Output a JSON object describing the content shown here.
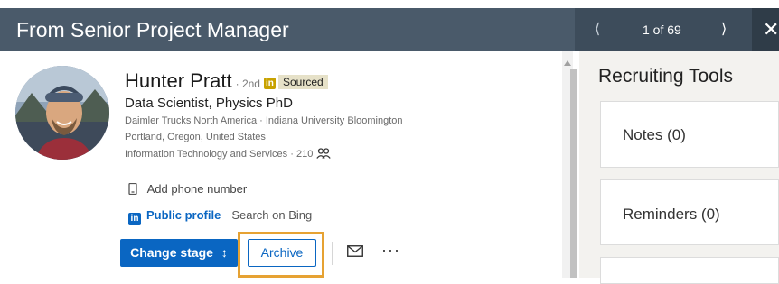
{
  "header": {
    "title": "From Senior Project Manager",
    "pager": {
      "prev_icon": "chevron-left-icon",
      "count": "1 of 69",
      "next_icon": "chevron-right-icon"
    },
    "close_icon": "close-icon"
  },
  "profile": {
    "name": "Hunter Pratt",
    "degree": "· 2nd",
    "badge": "Sourced",
    "headline": "Data Scientist, Physics PhD",
    "meta_line1": "Daimler Trucks North America · Indiana University Bloomington",
    "meta_line2": "Portland, Oregon, United States",
    "meta_line3": "Information Technology and Services · 210",
    "add_phone": "Add phone number",
    "public_profile": "Public profile",
    "search_bing": "Search on Bing"
  },
  "actions": {
    "change_stage": "Change stage",
    "archive": "Archive",
    "more": "···"
  },
  "recruiting_tools": {
    "title": "Recruiting Tools",
    "notes": "Notes (0)",
    "reminders": "Reminders (0)"
  },
  "colors": {
    "header_bg": "#4a5a6a",
    "linkedin_blue": "#0a66c2",
    "highlight": "#e6a233"
  }
}
